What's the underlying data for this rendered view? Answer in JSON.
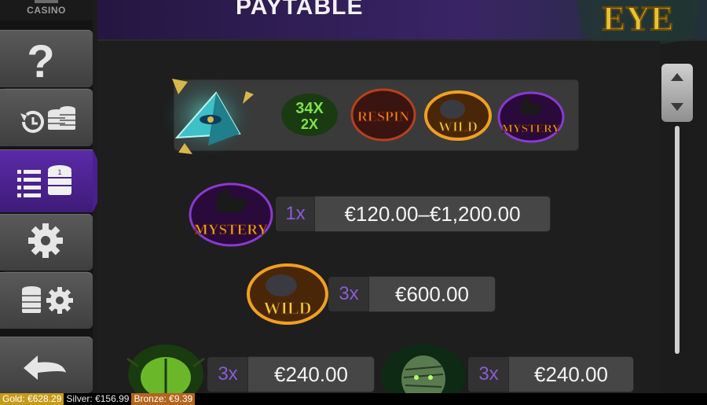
{
  "brand": {
    "label": "CASINO"
  },
  "header": {
    "title": "PAYTABLE",
    "game_logo_text": "EYE"
  },
  "sidebar": {
    "items": [
      {
        "name": "help",
        "icon": "question-mark-icon"
      },
      {
        "name": "history",
        "icon": "history-coins-icon"
      },
      {
        "name": "paytable",
        "icon": "paytable-list-coins-icon",
        "active": true
      },
      {
        "name": "settings",
        "icon": "gear-icon"
      },
      {
        "name": "bet-settings",
        "icon": "coins-gear-icon"
      },
      {
        "name": "back",
        "icon": "back-arrow-icon"
      }
    ]
  },
  "features": {
    "symbols": [
      {
        "name": "pyramid-eye-scatter",
        "text": ""
      },
      {
        "name": "multiplier",
        "text": "34X 2X"
      },
      {
        "name": "respin",
        "text": "RESPIN"
      },
      {
        "name": "wild",
        "text": "WILD"
      },
      {
        "name": "mystery",
        "text": "MYSTERY"
      }
    ]
  },
  "paytable": {
    "rows": [
      {
        "symbol": "MYSTERY",
        "mult": "1x",
        "value": "€120.00–€1,200.00"
      },
      {
        "symbol": "WILD",
        "mult": "3x",
        "value": "€600.00"
      },
      {
        "symbol": "scarab",
        "mult": "3x",
        "value": "€240.00"
      },
      {
        "symbol": "mummy",
        "mult": "3x",
        "value": "€240.00"
      }
    ]
  },
  "status_bar": {
    "gold": "Gold: €628.29",
    "silver": "Silver: €156.99",
    "bronze": "Bronze: €9.39"
  },
  "colors": {
    "accent_purple": "#5b2aa8",
    "multiplier_text": "#8c5bd6",
    "gold": "#c89a1a",
    "bronze": "#b5641c"
  }
}
